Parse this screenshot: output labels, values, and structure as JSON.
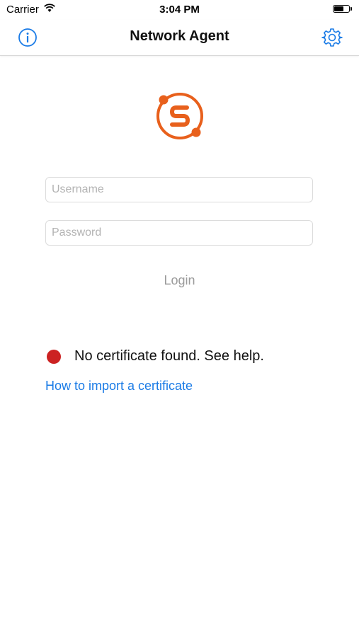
{
  "status_bar": {
    "carrier": "Carrier",
    "time": "3:04 PM",
    "battery_level": 0.7,
    "icons": [
      "wifi-icon",
      "battery-icon"
    ]
  },
  "nav": {
    "title": "Network Agent",
    "left_icon": "info-icon",
    "right_icon": "gear-icon"
  },
  "login": {
    "username_placeholder": "Username",
    "username_value": "",
    "password_placeholder": "Password",
    "password_value": "",
    "button_label": "Login"
  },
  "certificate": {
    "status_text": "No certificate found. See help.",
    "status_color": "#cc2222",
    "help_link": "How to import a certificate"
  },
  "colors": {
    "accent": "#1a7be6",
    "brand": "#e8601c"
  }
}
